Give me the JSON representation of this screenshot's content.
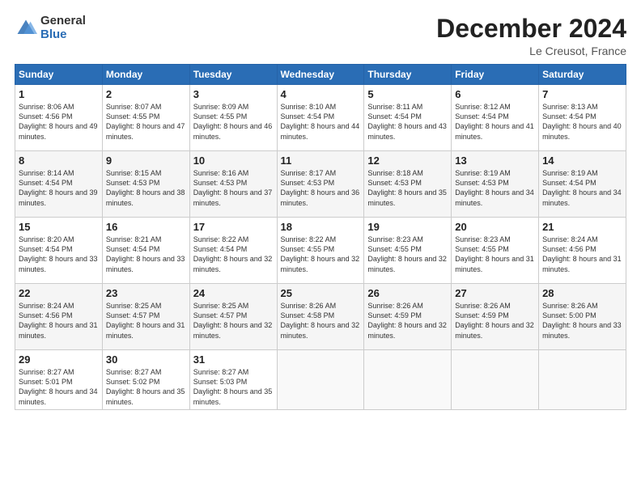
{
  "logo": {
    "general": "General",
    "blue": "Blue"
  },
  "header": {
    "title": "December 2024",
    "location": "Le Creusot, France"
  },
  "weekdays": [
    "Sunday",
    "Monday",
    "Tuesday",
    "Wednesday",
    "Thursday",
    "Friday",
    "Saturday"
  ],
  "weeks": [
    [
      {
        "day": "1",
        "sunrise": "8:06 AM",
        "sunset": "4:56 PM",
        "daylight": "8 hours and 49 minutes."
      },
      {
        "day": "2",
        "sunrise": "8:07 AM",
        "sunset": "4:55 PM",
        "daylight": "8 hours and 47 minutes."
      },
      {
        "day": "3",
        "sunrise": "8:09 AM",
        "sunset": "4:55 PM",
        "daylight": "8 hours and 46 minutes."
      },
      {
        "day": "4",
        "sunrise": "8:10 AM",
        "sunset": "4:54 PM",
        "daylight": "8 hours and 44 minutes."
      },
      {
        "day": "5",
        "sunrise": "8:11 AM",
        "sunset": "4:54 PM",
        "daylight": "8 hours and 43 minutes."
      },
      {
        "day": "6",
        "sunrise": "8:12 AM",
        "sunset": "4:54 PM",
        "daylight": "8 hours and 41 minutes."
      },
      {
        "day": "7",
        "sunrise": "8:13 AM",
        "sunset": "4:54 PM",
        "daylight": "8 hours and 40 minutes."
      }
    ],
    [
      {
        "day": "8",
        "sunrise": "8:14 AM",
        "sunset": "4:54 PM",
        "daylight": "8 hours and 39 minutes."
      },
      {
        "day": "9",
        "sunrise": "8:15 AM",
        "sunset": "4:53 PM",
        "daylight": "8 hours and 38 minutes."
      },
      {
        "day": "10",
        "sunrise": "8:16 AM",
        "sunset": "4:53 PM",
        "daylight": "8 hours and 37 minutes."
      },
      {
        "day": "11",
        "sunrise": "8:17 AM",
        "sunset": "4:53 PM",
        "daylight": "8 hours and 36 minutes."
      },
      {
        "day": "12",
        "sunrise": "8:18 AM",
        "sunset": "4:53 PM",
        "daylight": "8 hours and 35 minutes."
      },
      {
        "day": "13",
        "sunrise": "8:19 AM",
        "sunset": "4:53 PM",
        "daylight": "8 hours and 34 minutes."
      },
      {
        "day": "14",
        "sunrise": "8:19 AM",
        "sunset": "4:54 PM",
        "daylight": "8 hours and 34 minutes."
      }
    ],
    [
      {
        "day": "15",
        "sunrise": "8:20 AM",
        "sunset": "4:54 PM",
        "daylight": "8 hours and 33 minutes."
      },
      {
        "day": "16",
        "sunrise": "8:21 AM",
        "sunset": "4:54 PM",
        "daylight": "8 hours and 33 minutes."
      },
      {
        "day": "17",
        "sunrise": "8:22 AM",
        "sunset": "4:54 PM",
        "daylight": "8 hours and 32 minutes."
      },
      {
        "day": "18",
        "sunrise": "8:22 AM",
        "sunset": "4:55 PM",
        "daylight": "8 hours and 32 minutes."
      },
      {
        "day": "19",
        "sunrise": "8:23 AM",
        "sunset": "4:55 PM",
        "daylight": "8 hours and 32 minutes."
      },
      {
        "day": "20",
        "sunrise": "8:23 AM",
        "sunset": "4:55 PM",
        "daylight": "8 hours and 31 minutes."
      },
      {
        "day": "21",
        "sunrise": "8:24 AM",
        "sunset": "4:56 PM",
        "daylight": "8 hours and 31 minutes."
      }
    ],
    [
      {
        "day": "22",
        "sunrise": "8:24 AM",
        "sunset": "4:56 PM",
        "daylight": "8 hours and 31 minutes."
      },
      {
        "day": "23",
        "sunrise": "8:25 AM",
        "sunset": "4:57 PM",
        "daylight": "8 hours and 31 minutes."
      },
      {
        "day": "24",
        "sunrise": "8:25 AM",
        "sunset": "4:57 PM",
        "daylight": "8 hours and 32 minutes."
      },
      {
        "day": "25",
        "sunrise": "8:26 AM",
        "sunset": "4:58 PM",
        "daylight": "8 hours and 32 minutes."
      },
      {
        "day": "26",
        "sunrise": "8:26 AM",
        "sunset": "4:59 PM",
        "daylight": "8 hours and 32 minutes."
      },
      {
        "day": "27",
        "sunrise": "8:26 AM",
        "sunset": "4:59 PM",
        "daylight": "8 hours and 32 minutes."
      },
      {
        "day": "28",
        "sunrise": "8:26 AM",
        "sunset": "5:00 PM",
        "daylight": "8 hours and 33 minutes."
      }
    ],
    [
      {
        "day": "29",
        "sunrise": "8:27 AM",
        "sunset": "5:01 PM",
        "daylight": "8 hours and 34 minutes."
      },
      {
        "day": "30",
        "sunrise": "8:27 AM",
        "sunset": "5:02 PM",
        "daylight": "8 hours and 35 minutes."
      },
      {
        "day": "31",
        "sunrise": "8:27 AM",
        "sunset": "5:03 PM",
        "daylight": "8 hours and 35 minutes."
      },
      null,
      null,
      null,
      null
    ]
  ]
}
